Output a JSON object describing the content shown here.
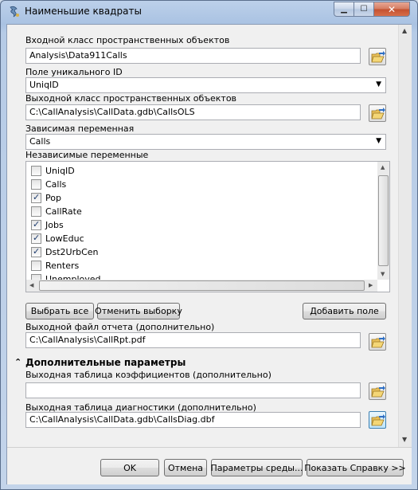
{
  "window": {
    "title": "Наименьшие квадраты",
    "minimize_glyph": "▁",
    "maximize_glyph": "☐",
    "close_glyph": "✕"
  },
  "form": {
    "input_class": {
      "label": "Входной класс пространственных объектов",
      "value": "Analysis\\Data911Calls"
    },
    "unique_field": {
      "label": "Поле уникального ID",
      "value": "UniqID"
    },
    "output_class": {
      "label": "Выходной класс пространственных объектов",
      "value": "C:\\CallAnalysis\\CallData.gdb\\CallsOLS"
    },
    "dependent_var": {
      "label": "Зависимая переменная",
      "value": "Calls"
    },
    "independent_vars": {
      "label": "Независимые переменные",
      "items": [
        {
          "label": "UniqID",
          "checked": false
        },
        {
          "label": "Calls",
          "checked": false
        },
        {
          "label": "Pop",
          "checked": true
        },
        {
          "label": "CallRate",
          "checked": false
        },
        {
          "label": "Jobs",
          "checked": true
        },
        {
          "label": "LowEduc",
          "checked": true
        },
        {
          "label": "Dst2UrbCen",
          "checked": true
        },
        {
          "label": "Renters",
          "checked": false
        },
        {
          "label": "Unemployed",
          "checked": false
        }
      ]
    },
    "select_all_label": "Выбрать все",
    "unselect_all_label": "Отменить выборку",
    "add_field_label": "Добавить поле",
    "report_file": {
      "label": "Выходной файл отчета (дополнительно)",
      "value": "C:\\CallAnalysis\\CallRpt.pdf"
    },
    "additional_section": {
      "title": "Дополнительные параметры",
      "collapse_glyph": "⌃"
    },
    "coef_table": {
      "label": "Выходная таблица коэффициентов (дополнительно)",
      "value": ""
    },
    "diag_table": {
      "label": "Выходная таблица диагностики (дополнительно)",
      "value": "C:\\CallAnalysis\\CallData.gdb\\CallsDiag.dbf"
    }
  },
  "footer": {
    "ok_label": "OK",
    "cancel_label": "Отмена",
    "env_label": "Параметры среды...",
    "help_label": "Показать Справку >>"
  },
  "icons": {
    "app": "arctoolbox-tool-icon",
    "folder": "open-folder-icon",
    "check": "✓",
    "combo_arrow": "▼"
  }
}
